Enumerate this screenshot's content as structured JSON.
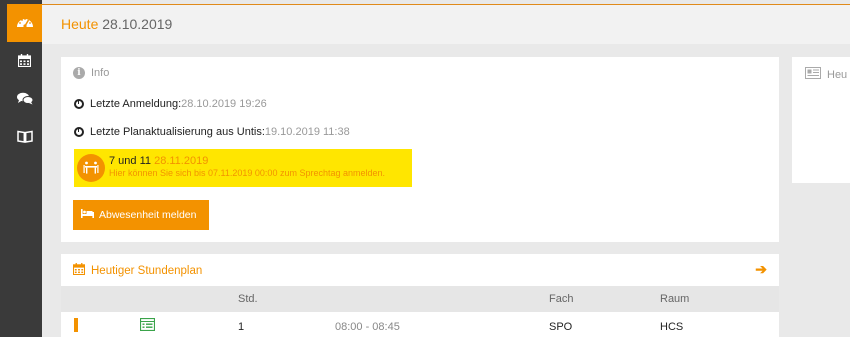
{
  "sidebar": {
    "items": [
      {
        "icon": "dashboard-icon"
      },
      {
        "icon": "calendar-icon"
      },
      {
        "icon": "chat-icon"
      },
      {
        "icon": "book-icon"
      }
    ]
  },
  "header": {
    "title_highlight": "Heute",
    "title_date": "28.10.2019"
  },
  "info": {
    "heading": "Info",
    "last_login_label": "Letzte Anmeldung:",
    "last_login_value": "28.10.2019 19:26",
    "last_update_label": "Letzte Planaktualisierung aus Untis:",
    "last_update_value": "19.10.2019 11:38",
    "notice": {
      "title": "7 und 11",
      "date": "28.11.2019",
      "text": "Hier können Sie sich bis 07.11.2019 00:00 zum Sprechtag anmelden."
    },
    "absence_button": "Abwesenheit melden"
  },
  "side_panel": {
    "heading": "Heu"
  },
  "schedule": {
    "heading": "Heutiger Stundenplan",
    "columns": [
      "Std.",
      "Fach",
      "Raum"
    ],
    "rows": [
      {
        "period": "1",
        "time": "08:00 - 08:45",
        "subject": "SPO",
        "room": "HCS"
      }
    ]
  },
  "colors": {
    "accent": "#f39200",
    "notice_bg": "#ffe600",
    "sidebar_bg": "#3a3a3a"
  }
}
